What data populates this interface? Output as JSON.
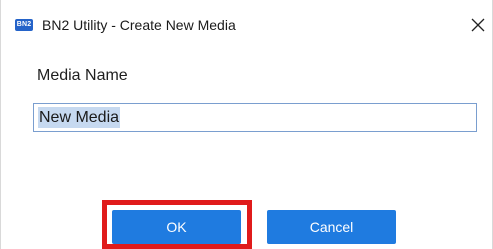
{
  "window": {
    "title": "BN2 Utility - Create New Media",
    "app_icon_text": "BN2",
    "icon": "app-logo-icon",
    "close_icon": "close-icon"
  },
  "form": {
    "media_name_label": "Media Name",
    "media_name_value": "New Media",
    "media_name_selected": true
  },
  "buttons": {
    "ok_label": "OK",
    "cancel_label": "Cancel"
  },
  "annotation": {
    "highlight_target": "ok-button",
    "color": "#e01b1b"
  },
  "colors": {
    "accent": "#1f7be0",
    "selection": "#c6d9f0",
    "input_border": "#7a9ecf"
  }
}
